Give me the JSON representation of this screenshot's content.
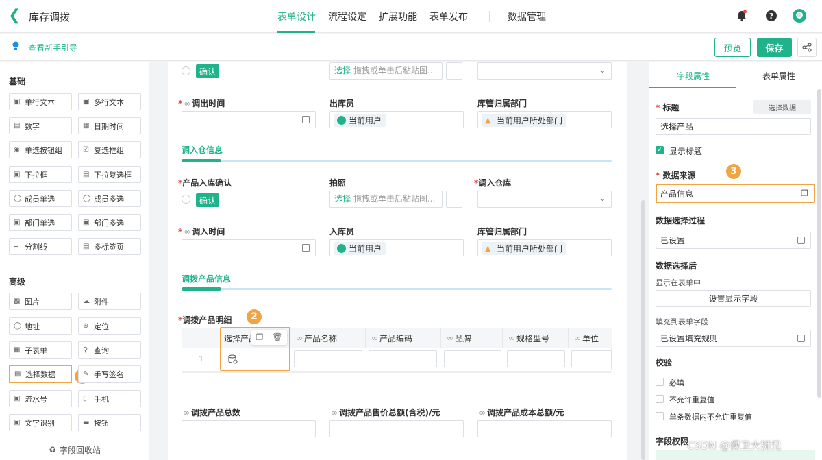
{
  "header": {
    "title": "库存调拨",
    "tabs": [
      {
        "label": "表单设计",
        "active": true
      },
      {
        "label": "流程设定",
        "active": false
      },
      {
        "label": "扩展功能",
        "active": false
      },
      {
        "label": "表单发布",
        "active": false
      },
      {
        "label": "数据管理",
        "active": false
      }
    ],
    "icons": [
      "bell-icon",
      "help-icon",
      "avatar"
    ]
  },
  "guidebar": {
    "guide_link": "查看新手引导",
    "preview_label": "预览",
    "save_label": "保存"
  },
  "left_panel": {
    "basic_title": "基础",
    "basic_items": [
      "单行文本",
      "多行文本",
      "数字",
      "日期时间",
      "单选按钮组",
      "复选框组",
      "下拉框",
      "下拉复选框",
      "成员单选",
      "成员多选",
      "部门单选",
      "部门多选",
      "分割线",
      "多标签页"
    ],
    "advanced_title": "高级",
    "advanced_items": [
      "图片",
      "附件",
      "地址",
      "定位",
      "子表单",
      "查询",
      "选择数据",
      "手写签名",
      "流水号",
      "手机",
      "文字识别",
      "按钮"
    ],
    "recycle_label": "字段回收站"
  },
  "canvas": {
    "confirm_tag": "确认",
    "pick_text": "选择",
    "pick_placeholder": "拖拽或单击后粘贴图...",
    "current_user": "当前用户",
    "current_dept": "当前用户所处部门",
    "row1": {
      "out_time": "调出时间",
      "out_staff": "出库员",
      "out_dept": "库管归属部门"
    },
    "section_in": "调入仓信息",
    "row2": {
      "product_confirm": "产品入库确认",
      "photo": "拍照",
      "in_warehouse": "调入仓库"
    },
    "row3": {
      "in_time": "调入时间",
      "in_staff": "入库员",
      "in_dept": "库管归属部门"
    },
    "section_products": "调拨产品信息",
    "detail_title": "调拨产品明细",
    "table": {
      "columns": [
        "选择产品",
        "产品名称",
        "产品编码",
        "品牌",
        "规格型号",
        "单位"
      ],
      "row_number": "1"
    },
    "totals": {
      "total_count": "调拨产品总数",
      "total_price": "调拨产品售价总额(含税)/元",
      "total_cost": "调拨产品成本总额/元"
    }
  },
  "right_panel": {
    "tabs": [
      {
        "label": "字段属性",
        "active": true
      },
      {
        "label": "表单属性",
        "active": false
      }
    ],
    "title_label": "标题",
    "select_data_btn": "选择数据",
    "title_value": "选择产品",
    "show_title": "显示标题",
    "data_source_label": "数据来源",
    "data_source_value": "产品信息",
    "process_label": "数据选择过程",
    "process_value": "已设置",
    "after_label": "数据选择后",
    "show_in_form": "显示在表单中",
    "set_display_btn": "设置显示字段",
    "fill_to_field": "填充到表单字段",
    "fill_value": "已设置填充规则",
    "validate_label": "校验",
    "checks": [
      "必填",
      "不允许重复值",
      "单条数据内不允许重复值"
    ],
    "permission_label": "字段权限"
  },
  "annotations": [
    "1",
    "2",
    "3"
  ],
  "watermark": "CSDN @保卫大狮兄",
  "colors": {
    "accent": "#20b38b",
    "highlight": "#f0a442",
    "required": "#e54545"
  }
}
